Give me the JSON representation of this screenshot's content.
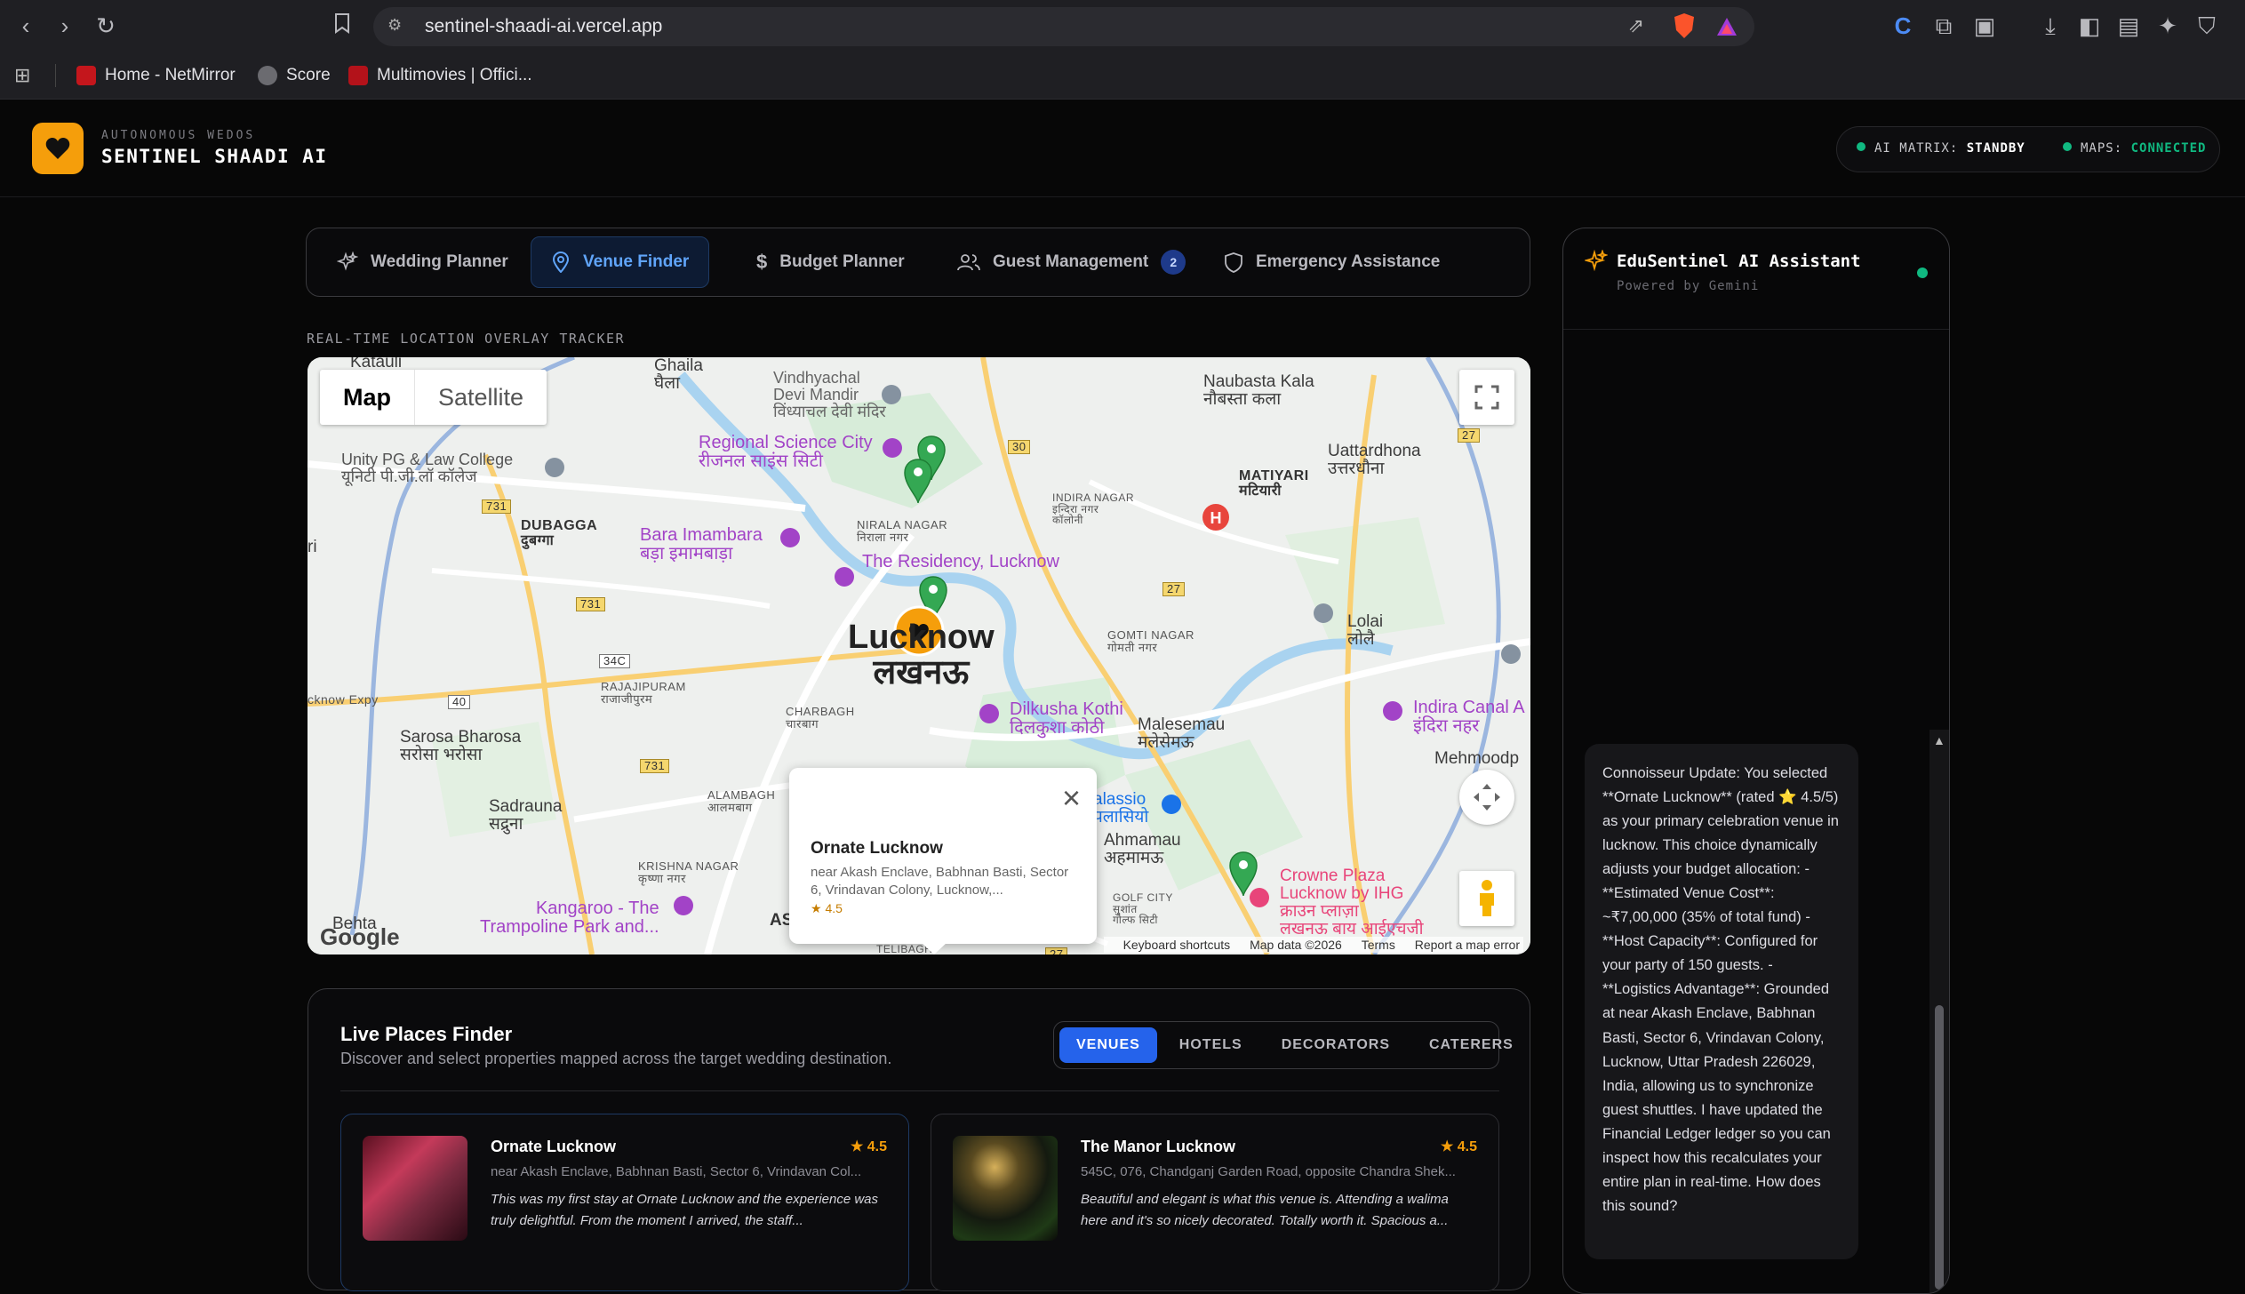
{
  "browser": {
    "url": "sentinel-shaadi-ai.vercel.app",
    "bookmarks": [
      "Home - NetMirror",
      "Score",
      "Multimovies | Offici..."
    ]
  },
  "header": {
    "kicker": "AUTONOMOUS WEDOS",
    "title": "SENTINEL SHAADI AI",
    "status": [
      {
        "label": "AI MATRIX:",
        "value": "STANDBY"
      },
      {
        "label": "MAPS:",
        "value": "CONNECTED"
      }
    ]
  },
  "tabs": [
    {
      "label": "Wedding Planner",
      "icon": "sparkles-icon"
    },
    {
      "label": "Venue Finder",
      "icon": "map-pin-icon",
      "active": true
    },
    {
      "label": "Budget Planner",
      "icon": "dollar-icon"
    },
    {
      "label": "Guest Management",
      "icon": "users-icon",
      "badge": "2"
    },
    {
      "label": "Emergency Assistance",
      "icon": "shield-icon"
    }
  ],
  "tracker_label": "REAL-TIME LOCATION OVERLAY TRACKER",
  "map": {
    "type_buttons": [
      "Map",
      "Satellite"
    ],
    "labels": {
      "katauli": "Katauli",
      "ghaila": "Ghaila\nघैला",
      "vindhyachal": "Vindhyachal\nDevi Mandir\nविंध्याचल देवी मंदिर",
      "naubasta": "Naubasta Kala\nनौबस्ता कला",
      "uattardhona": "Uattardhona\nउत्तरधौना",
      "matiyari": "MATIYARI\nमटियारी",
      "unity": "Unity PG & Law College\nयूनिटी पी.जी.लॉ कॉलेज",
      "regional": "Regional Science City\nरीजनल साइंस सिटी",
      "indira": "INDIRA NAGAR\nइन्दिरा नगर\nकॉलोनी",
      "dubagga": "DUBAGGA\nदुबग्गा",
      "bara": "Bara Imambara\nबड़ा इमामबाड़ा",
      "nirala": "NIRALA NAGAR\nनिराला नगर",
      "residency": "The Residency, Lucknow",
      "lucknow": "Lucknow\nलखनऊ",
      "gomti": "GOMTI NAGAR\nगोमती नगर",
      "lolai": "Lolai\nलोलै",
      "rajajipuram": "RAJAJIPURAM\nराजाजीपुरम",
      "charbagh": "CHARBAGH\nचारबाग",
      "dilkusha": "Dilkusha Kothi\nदिलकुशा कोठी",
      "malesemau": "Malesemau\nमलेसेमऊ",
      "indira_canal": "Indira Canal A\nइंदिरा नहर",
      "sarosa": "Sarosa Bharosa\nसरोसा भरोसा",
      "mehmoodp": "Mehmoodp",
      "alambagh": "ALAMBAGH\nआलमबाग",
      "sadrauna": "Sadrauna\nसद्रुना",
      "ahmamau": "Ahmamau\nअहमामऊ",
      "krishna": "KRISHNA NAGAR\nकृष्णा नगर",
      "kangaroo": "Kangaroo - The\nTrampoline Park and...",
      "golf": "GOLF CITY\nसुशांत\nगोल्फ सिटी",
      "crowne": "Crowne Plaza\nLucknow by IHG\nक्राउन प्लाज़ा\nलखनऊ बाय आईएचजी",
      "palassio": "alassio\nपलासियो",
      "behta": "Behta",
      "expy": "cknow Expy",
      "ri": "ri",
      "telibagh": "TELIBAGH",
      "as": "AS"
    },
    "road_shields": [
      "731",
      "731",
      "731",
      "30",
      "27",
      "27",
      "34C",
      "40",
      "27"
    ],
    "info_window": {
      "title": "Ornate Lucknow",
      "address": "near Akash Enclave, Babhnan Basti, Sector 6, Vrindavan Colony, Lucknow,...",
      "rating": "★ 4.5"
    },
    "footer": [
      "Keyboard shortcuts",
      "Map data ©2026",
      "Terms",
      "Report a map error"
    ],
    "logo": "Google"
  },
  "places": {
    "title": "Live Places Finder",
    "subtitle": "Discover and select properties mapped across the target wedding destination.",
    "categories": [
      "VENUES",
      "HOTELS",
      "DECORATORS",
      "CATERERS"
    ],
    "cards": [
      {
        "name": "Ornate Lucknow",
        "rating": "★ 4.5",
        "address": "near Akash Enclave, Babhnan Basti, Sector 6, Vrindavan Col...",
        "review": "This was my first stay at Ornate Lucknow and the experience was truly delightful. From the moment I arrived, the staff..."
      },
      {
        "name": "The Manor Lucknow",
        "rating": "★ 4.5",
        "address": "545C, 076, Chandganj Garden Road, opposite Chandra Shek...",
        "review": "Beautiful and elegant is what this venue is. Attending a walima here and it's so nicely decorated. Totally worth it. Spacious a..."
      }
    ]
  },
  "assistant": {
    "title": "EduSentinel AI Assistant",
    "powered": "Powered by Gemini",
    "message": "Connoisseur Update: You selected **Ornate Lucknow** (rated ⭐ 4.5/5) as your primary celebration venue in lucknow. This choice dynamically adjusts your budget allocation: - **Estimated Venue Cost**: ~₹7,00,000 (35% of total fund) - **Host Capacity**: Configured for your party of 150 guests. - **Logistics Advantage**: Grounded at near Akash Enclave, Babhnan Basti, Sector 6, Vrindavan Colony, Lucknow, Uttar Pradesh 226029, India, allowing us to synchronize guest shuttles. I have updated the Financial Ledger ledger so you can inspect how this recalculates your entire plan in real-time. How does this sound?"
  },
  "colors": {
    "accent_orange": "#f59e0b",
    "accent_blue": "#2563eb",
    "status_green": "#10b981",
    "marker_green": "#34a853",
    "background": "#070707"
  }
}
